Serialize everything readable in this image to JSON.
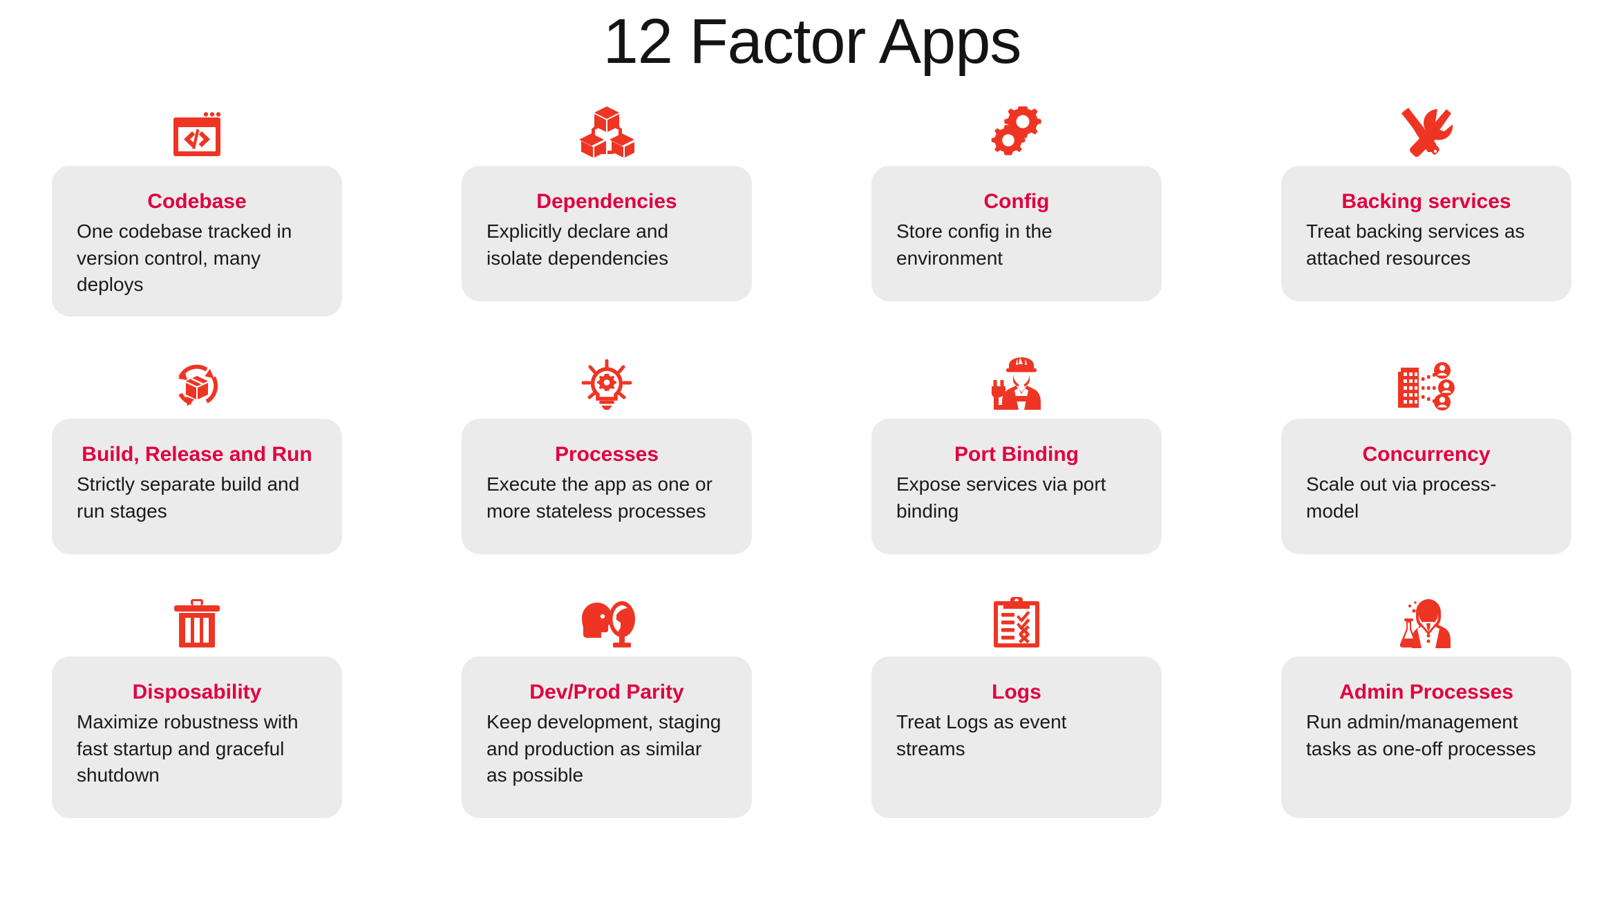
{
  "title": "12 Factor Apps",
  "theme": {
    "background": "#ffffff",
    "card_background": "#ebebeb",
    "title_color": "#141414",
    "card_title_color": "#e00040",
    "card_desc_color": "#1a1a1a",
    "icon_color": "#ee3524"
  },
  "rows": [
    {
      "cells": [
        {
          "icon": "code-window-icon",
          "title": "Codebase",
          "desc": "One codebase tracked in version control, many deploys"
        },
        {
          "icon": "cubes-dependency-icon",
          "title": "Dependencies",
          "desc": "Explicitly declare and isolate dependencies"
        },
        {
          "icon": "gears-icon",
          "title": "Config",
          "desc": "Store config in the environment"
        },
        {
          "icon": "wrench-screwdriver-icon",
          "title": "Backing services",
          "desc": "Treat backing services as attached resources"
        }
      ]
    },
    {
      "cells": [
        {
          "icon": "box-recycle-icon",
          "title": "Build, Release and Run",
          "desc": "Strictly separate build and run stages"
        },
        {
          "icon": "lightbulb-gear-icon",
          "title": "Processes",
          "desc": "Execute the app as one or more stateless processes"
        },
        {
          "icon": "worker-plug-icon",
          "title": "Port Binding",
          "desc": "Expose services via port binding"
        },
        {
          "icon": "building-users-icon",
          "title": "Concurrency",
          "desc": "Scale out via process-model"
        }
      ]
    },
    {
      "cells": [
        {
          "icon": "trash-can-icon",
          "title": "Disposability",
          "desc": "Maximize robustness with fast startup and graceful shutdown"
        },
        {
          "icon": "head-mirror-icon",
          "title": "Dev/Prod Parity",
          "desc": "Keep development, staging and production as similar as possible"
        },
        {
          "icon": "clipboard-checklist-icon",
          "title": "Logs",
          "desc": "Treat Logs as event streams"
        },
        {
          "icon": "scientist-flask-icon",
          "title": "Admin Processes",
          "desc": "Run admin/management tasks as one-off processes"
        }
      ]
    }
  ]
}
